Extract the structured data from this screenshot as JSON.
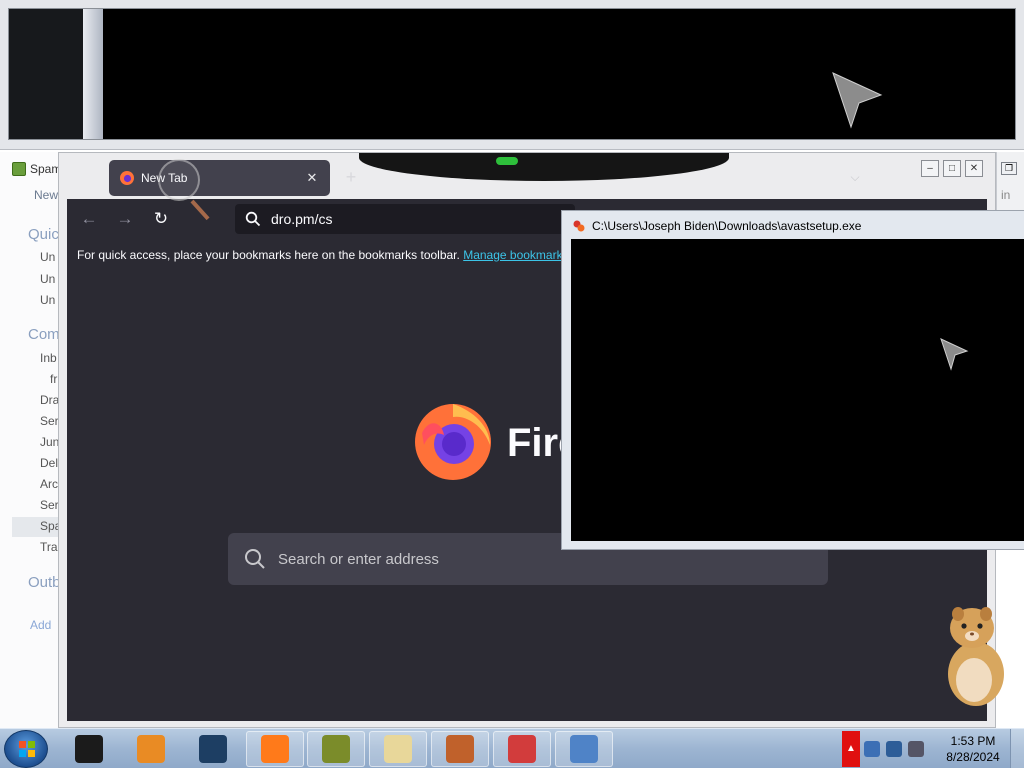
{
  "mail": {
    "title": "Spam",
    "new_label": "New",
    "sections": [
      "Quick",
      "Com",
      "Outb"
    ],
    "quick_items": [
      "Un",
      "Un",
      "Un"
    ],
    "folder_items": [
      "Inb",
      "fr",
      "Dra",
      "Ser",
      "Jun",
      "Del",
      "Arc",
      "Ser",
      "Spa",
      "Tra"
    ],
    "add_label": "Add"
  },
  "right_window": {
    "text": "in"
  },
  "firefox": {
    "tab_title": "New Tab",
    "url": "dro.pm/cs",
    "bookmarks_hint": "For quick access, place your bookmarks here on the bookmarks toolbar.",
    "bookmarks_link": "Manage bookmarks",
    "wordmark": "Fire",
    "search_placeholder": "Search or enter address"
  },
  "console": {
    "title": "C:\\Users\\Joseph Biden\\Downloads\\avastsetup.exe"
  },
  "taskbar": {
    "tray_flag": "▲",
    "time": "1:53 PM",
    "date": "8/28/2024",
    "buttons": [
      {
        "name": "taskbar-terminal",
        "color": "#1b1b1b"
      },
      {
        "name": "taskbar-media-player",
        "color": "#e98b24"
      },
      {
        "name": "taskbar-globe",
        "color": "#1d3e63"
      },
      {
        "name": "taskbar-firefox",
        "color": "#ff7a1a"
      },
      {
        "name": "taskbar-game",
        "color": "#7b8c2a"
      },
      {
        "name": "taskbar-mail",
        "color": "#e8d79a"
      },
      {
        "name": "taskbar-film-tool",
        "color": "#c0612b"
      },
      {
        "name": "taskbar-dice-game",
        "color": "#d23c3c"
      },
      {
        "name": "taskbar-search-tool",
        "color": "#4f83c7"
      }
    ]
  },
  "colors": {
    "firefox_bg": "#2b2a33",
    "link": "#3cc4e8",
    "taskbar": "#9db5d2"
  }
}
